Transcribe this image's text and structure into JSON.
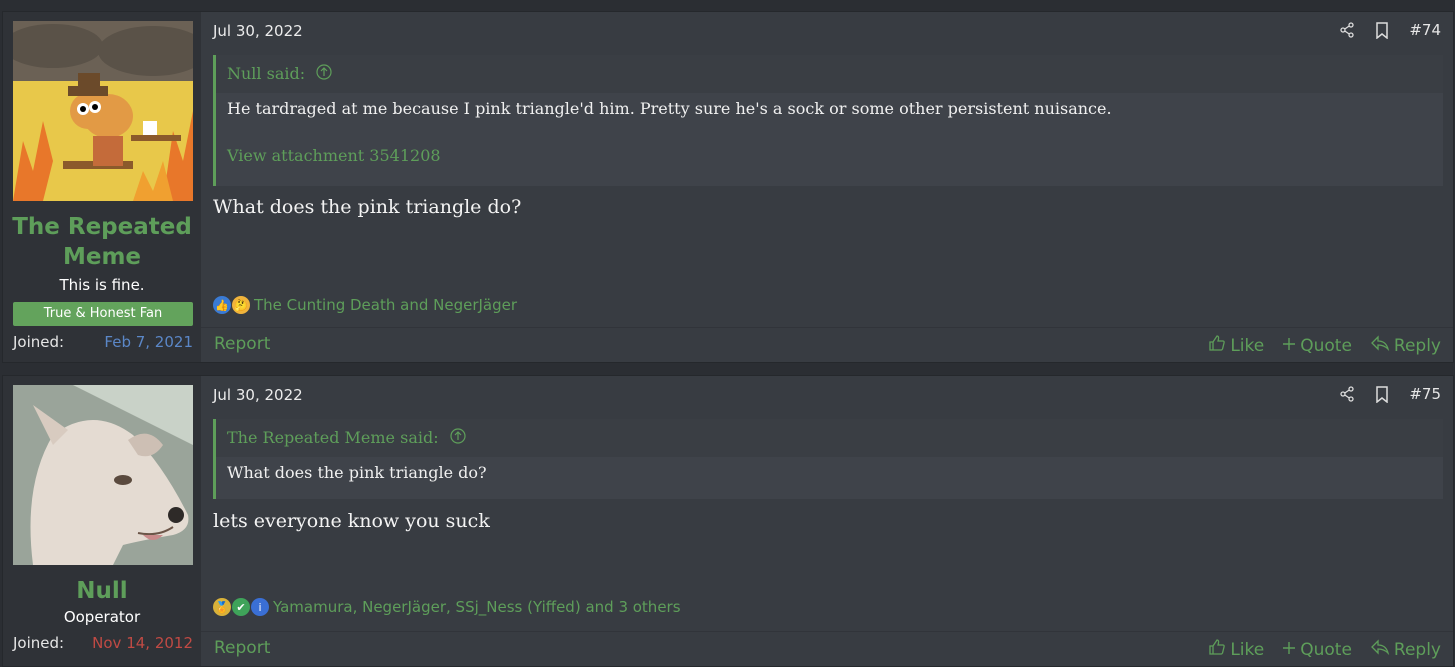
{
  "posts": [
    {
      "username": "The Repeated Meme",
      "user_title": "This is fine.",
      "banner": "True & Honest Fan",
      "joined_label": "Joined:",
      "joined_date": "Feb 7, 2021",
      "joined_color": "#5b87c7",
      "date": "Jul 30, 2022",
      "post_number": "#74",
      "quote_author": "Null said:",
      "quote_text": "He tardraged at me because I pink triangle'd him. Pretty sure he's a sock or some other persistent nuisance.",
      "quote_attachment": "View attachment 3541208",
      "message": "What does the pink triangle do?",
      "reactions_text": "The Cunting Death and NegerJäger",
      "report": "Report",
      "like": "Like",
      "quote": "Quote",
      "reply": "Reply"
    },
    {
      "username": "Null",
      "user_title": "Ooperator",
      "joined_label": "Joined:",
      "joined_date": "Nov 14, 2012",
      "joined_color": "#c04a44",
      "date": "Jul 30, 2022",
      "post_number": "#75",
      "quote_author": "The Repeated Meme said:",
      "quote_text": "What does the pink triangle do?",
      "message": "lets everyone know you suck",
      "reactions_text": "Yamamura, NegerJäger, SSj_Ness (Yiffed) and 3 others",
      "report": "Report",
      "like": "Like",
      "quote": "Quote",
      "reply": "Reply"
    }
  ],
  "colors": {
    "accent": "#5e9e5a",
    "background": "#383c42",
    "user_cell": "#2f3237"
  }
}
